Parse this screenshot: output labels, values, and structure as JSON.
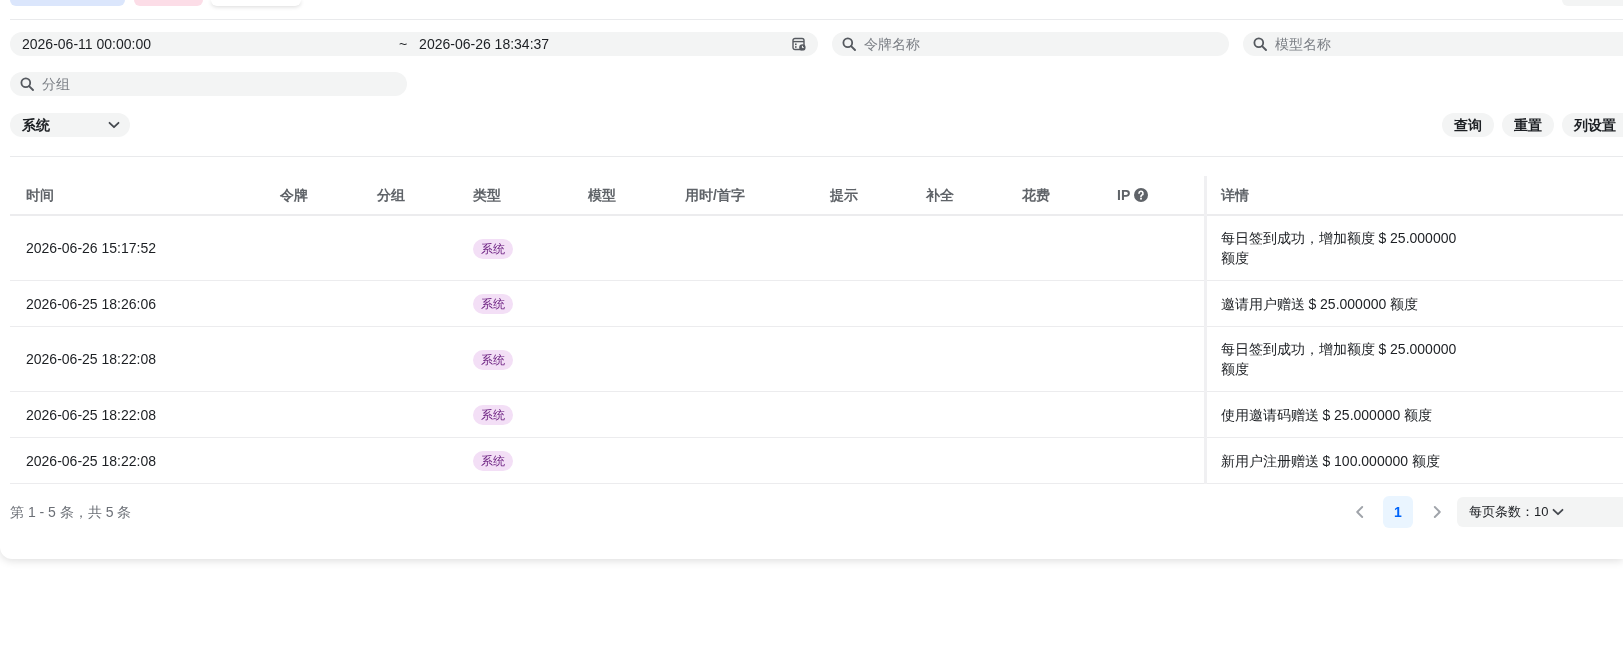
{
  "filters": {
    "date_range": {
      "start": "2026-06-11 00:00:00",
      "separator": "~",
      "end": "2026-06-26 18:34:37"
    },
    "token_search": {
      "placeholder": "令牌名称"
    },
    "model_search": {
      "placeholder": "模型名称"
    },
    "group_search": {
      "placeholder": "分组"
    },
    "log_type": {
      "value": "系统"
    }
  },
  "actions": [
    "查询",
    "重置",
    "列设置"
  ],
  "table": {
    "columns": [
      {
        "label": "时间"
      },
      {
        "label": "令牌"
      },
      {
        "label": "分组"
      },
      {
        "label": "类型"
      },
      {
        "label": "模型"
      },
      {
        "label": "用时/首字"
      },
      {
        "label": "提示"
      },
      {
        "label": "补全"
      },
      {
        "label": "花费"
      },
      {
        "label": "IP",
        "help": true
      },
      {
        "label": "详情"
      }
    ],
    "rows": [
      {
        "time": "2026-06-26 15:17:52",
        "type": "系统",
        "detail": "每日签到成功，增加额度 $ 25.000000 额度"
      },
      {
        "time": "2026-06-25 18:26:06",
        "type": "系统",
        "detail": "邀请用户赠送 $ 25.000000 额度"
      },
      {
        "time": "2026-06-25 18:22:08",
        "type": "系统",
        "detail": "每日签到成功，增加额度 $ 25.000000 额度"
      },
      {
        "time": "2026-06-25 18:22:08",
        "type": "系统",
        "detail": "使用邀请码赠送 $ 25.000000 额度"
      },
      {
        "time": "2026-06-25 18:22:08",
        "type": "系统",
        "detail": "新用户注册赠送 $ 100.000000 额度"
      }
    ]
  },
  "pagination": {
    "summary": "第 1 - 5 条，共 5 条",
    "pages": [
      {
        "label": "1",
        "selected": true
      }
    ],
    "page_size": "每页条数：10"
  }
}
